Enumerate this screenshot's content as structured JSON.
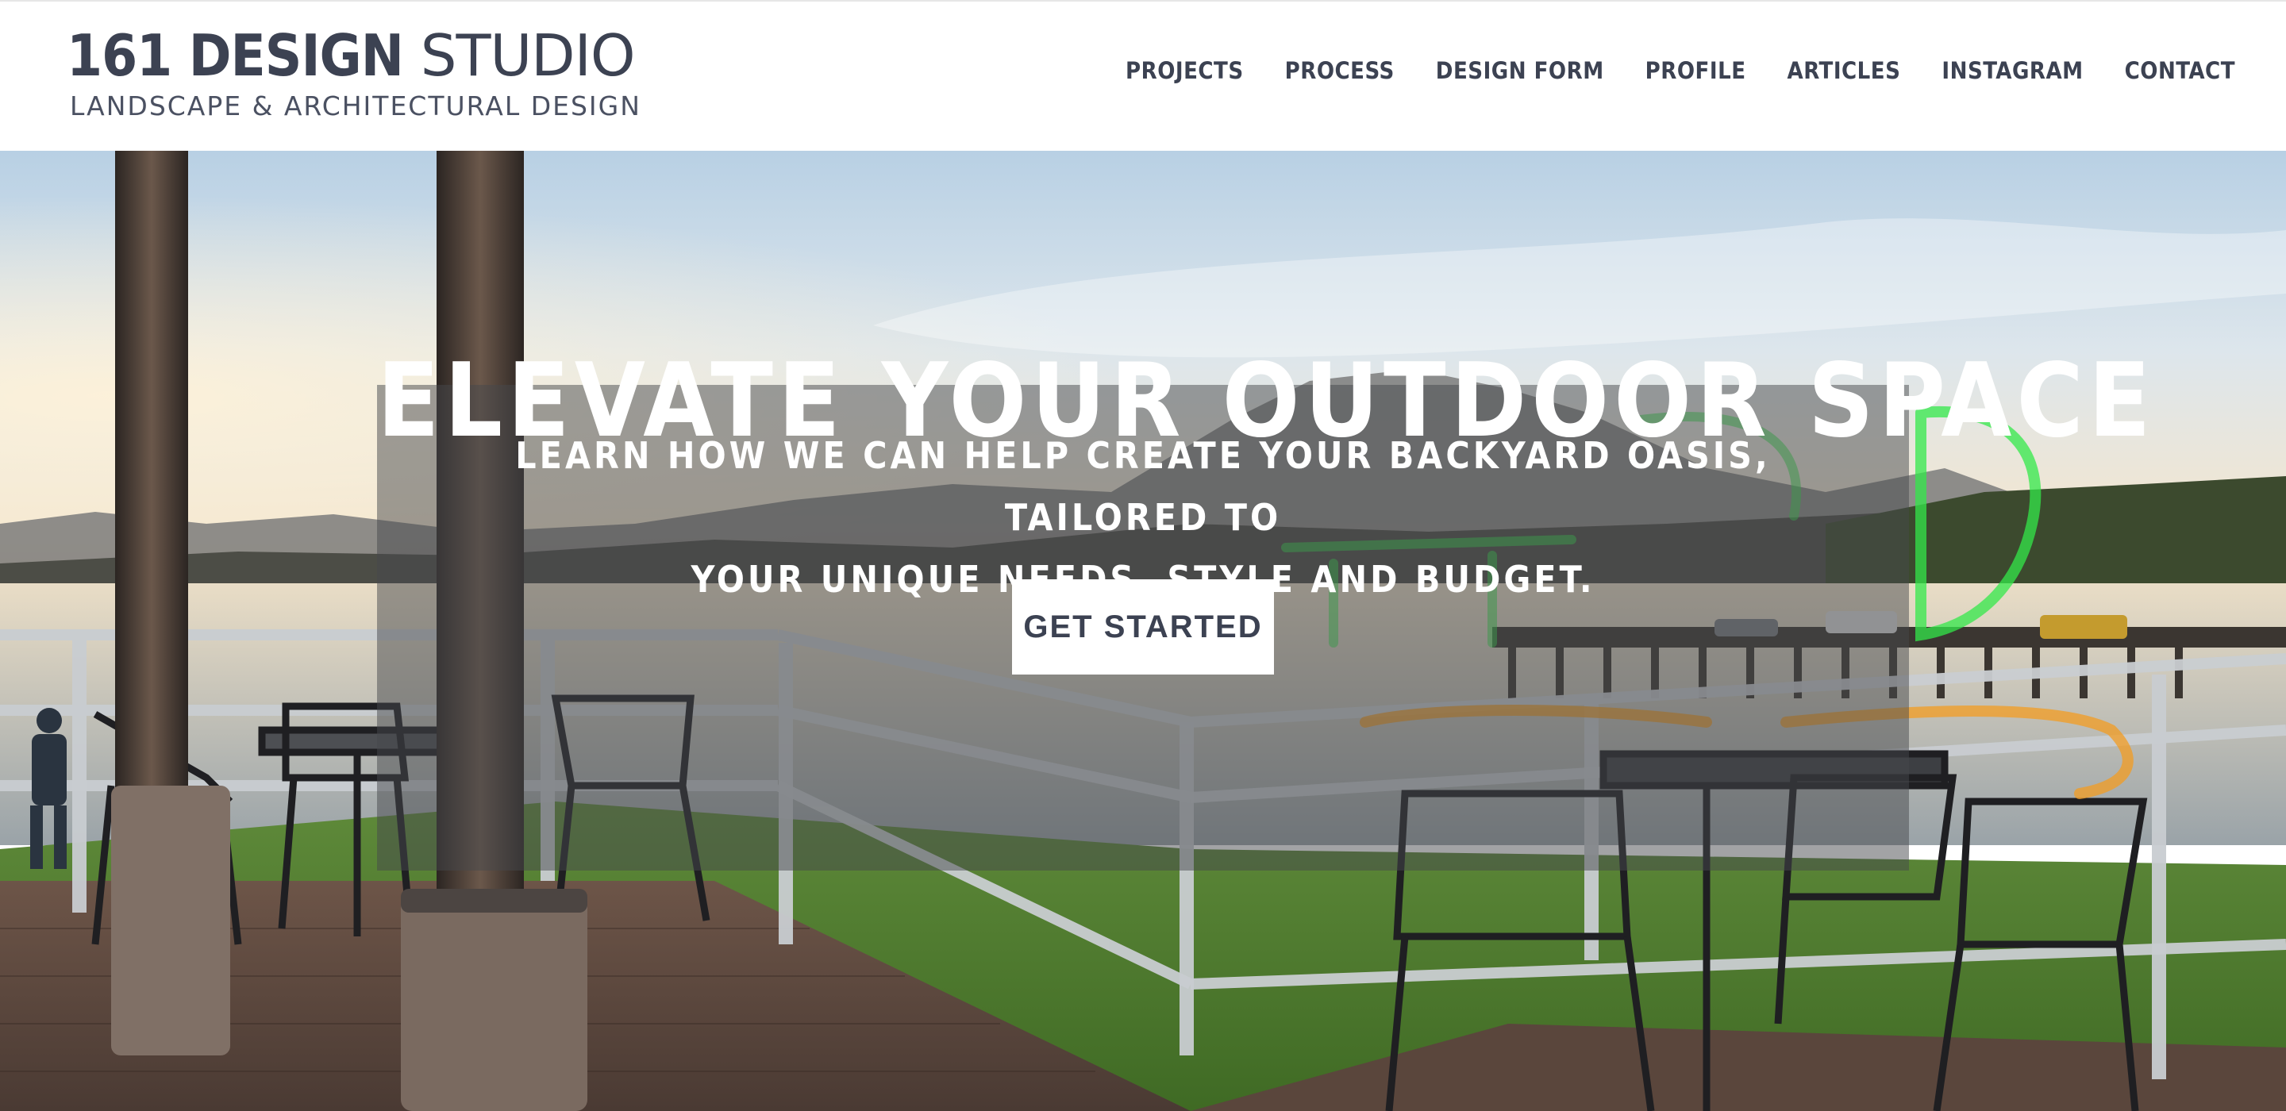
{
  "brand": {
    "title_bold": "161 DESIGN",
    "title_light": " STUDIO",
    "subtitle": "LANDSCAPE & ARCHITECTURAL DESIGN",
    "color": "#3c4252"
  },
  "nav": {
    "items": [
      {
        "label": "PROJECTS"
      },
      {
        "label": "PROCESS"
      },
      {
        "label": "DESIGN FORM"
      },
      {
        "label": "PROFILE"
      },
      {
        "label": "ARTICLES"
      },
      {
        "label": "INSTAGRAM"
      },
      {
        "label": "CONTACT"
      }
    ]
  },
  "hero": {
    "headline": "ELEVATE YOUR OUTDOOR SPACE",
    "subtext_line1": "LEARN HOW WE CAN HELP CREATE YOUR BACKYARD OASIS, TAILORED TO",
    "subtext_line2": "YOUR UNIQUE NEEDS, STYLE AND BUDGET.",
    "cta_label": "GET STARTED",
    "overlay_color": "#46484c"
  }
}
